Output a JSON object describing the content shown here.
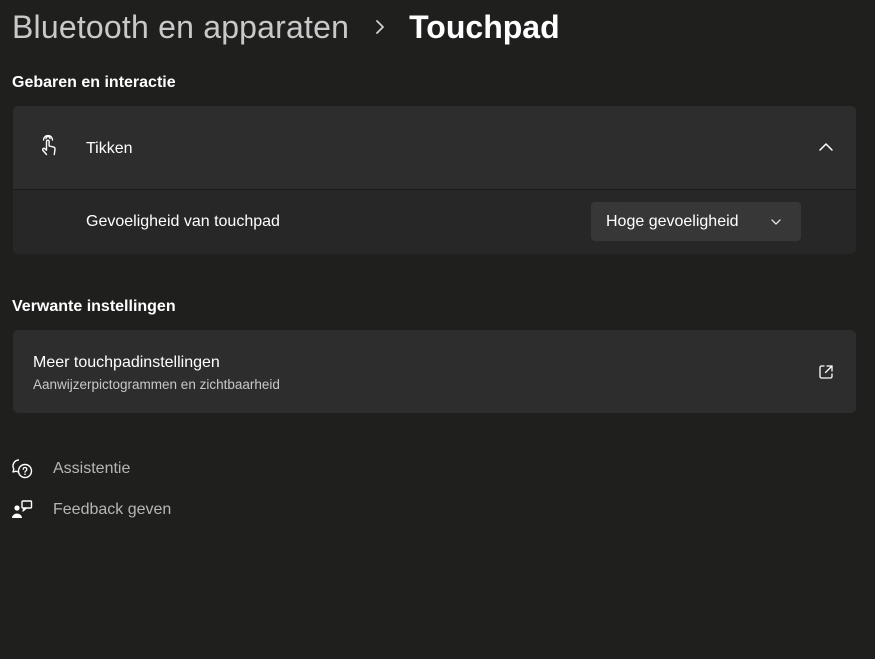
{
  "breadcrumb": {
    "parent": "Bluetooth en apparaten",
    "current": "Touchpad"
  },
  "sections": {
    "gestures_title": "Gebaren en interactie",
    "related_title": "Verwante instellingen"
  },
  "tap_card": {
    "title": "Tikken",
    "icon": "tap-gesture-icon",
    "expanded": true,
    "sensitivity_label": "Gevoeligheid van touchpad",
    "sensitivity_value": "Hoge gevoeligheid"
  },
  "related": {
    "title": "Meer touchpadinstellingen",
    "subtitle": "Aanwijzerpictogrammen en zichtbaarheid",
    "icon": "open-external-icon"
  },
  "help": {
    "assist_label": "Assistentie",
    "feedback_label": "Feedback geven"
  }
}
